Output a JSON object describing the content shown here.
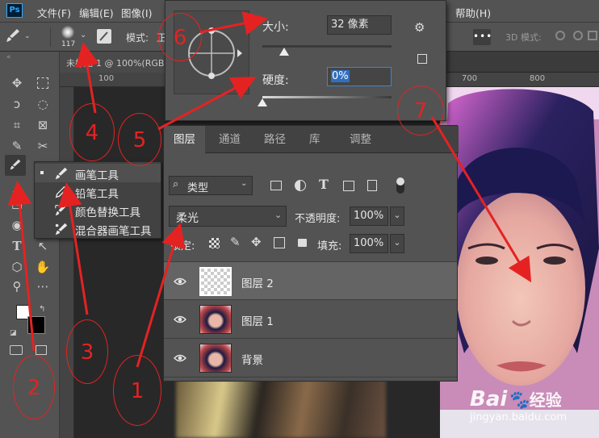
{
  "app": {
    "logo": "Ps",
    "menus": [
      "文件(F)",
      "编辑(E)",
      "图像(I)",
      "帮助(H)"
    ]
  },
  "options_bar": {
    "brush_size_label": "117",
    "mode_label": "模式:",
    "mode_value_partial": "正",
    "three_d_mode_label": "3D 模式:"
  },
  "document": {
    "tab_title": "未标题-1 @ 100%(RGB",
    "ruler_marks": [
      "100",
      "700",
      "800"
    ]
  },
  "brush_picker": {
    "size_label": "大小:",
    "size_value": "32 像素",
    "hardness_label": "硬度:",
    "hardness_value": "0%",
    "size_slider_fraction": 0.17,
    "hardness_slider_fraction": 0.0
  },
  "tool_flyout": {
    "items": [
      {
        "label": "画笔工具",
        "selected": true
      },
      {
        "label": "铅笔工具",
        "selected": false
      },
      {
        "label": "颜色替换工具",
        "selected": false
      },
      {
        "label": "混合器画笔工具",
        "selected": false
      }
    ]
  },
  "layers_panel": {
    "tabs": [
      "图层",
      "通道",
      "路径",
      "库",
      "调整"
    ],
    "active_tab": "图层",
    "filter_label": "类型",
    "blend_mode": "柔光",
    "opacity_label": "不透明度:",
    "opacity_value": "100%",
    "lock_label": "锁定:",
    "fill_label": "填充:",
    "fill_value": "100%",
    "layers": [
      {
        "name": "图层 2",
        "active": true,
        "thumb": "transparent"
      },
      {
        "name": "图层 1",
        "active": false,
        "thumb": "photo"
      },
      {
        "name": "背景",
        "active": false,
        "thumb": "photo"
      }
    ]
  },
  "annotations": {
    "numbers": [
      "1",
      "2",
      "3",
      "4",
      "5",
      "6",
      "7"
    ],
    "color": "#e52222"
  },
  "watermark": {
    "brand": "Bai",
    "brand_tail": "经验",
    "url": "jingyan.baidu.com"
  },
  "colors": {
    "panel_bg": "#535353",
    "dark_bg": "#282828",
    "accent_blue": "#31a8ff",
    "annotation_red": "#e52222"
  }
}
